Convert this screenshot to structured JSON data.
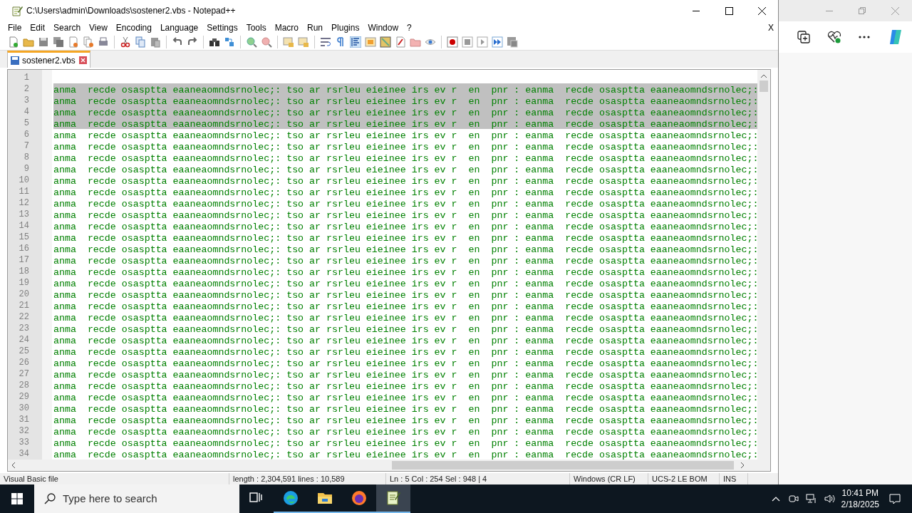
{
  "window": {
    "title": "C:\\Users\\admin\\Downloads\\sostener2.vbs - Notepad++"
  },
  "menu": [
    "File",
    "Edit",
    "Search",
    "View",
    "Encoding",
    "Language",
    "Settings",
    "Tools",
    "Macro",
    "Run",
    "Plugins",
    "Window",
    "?"
  ],
  "menu_close": "X",
  "tabs": [
    {
      "label": "sostener2.vbs",
      "selected": true
    }
  ],
  "editor": {
    "lines": [
      {
        "number": "1",
        "selected": false
      },
      {
        "number": "2",
        "text": "anma  recde osasptta eaaneaomndsrnolec;: tso ar rsrleu eieinee irs ev r  en  pnr : eanma  recde osasptta eaaneaomndsrnolec;:",
        "selected": true
      },
      {
        "number": "3",
        "text": "anma  recde osasptta eaaneaomndsrnolec;: tso ar rsrleu eieinee irs ev r  en  pnr : eanma  recde osasptta eaaneaomndsrnolec;:",
        "selected": true
      },
      {
        "number": "4",
        "text": "anma  recde osasptta eaaneaomndsrnolec;: tso ar rsrleu eieinee irs ev r  en  pnr : eanma  recde osasptta eaaneaomndsrnolec;:",
        "selected": true
      },
      {
        "number": "5",
        "text": "anma  recde osasptta eaaneaomndsrnolec;: tso ar rsrleu eieinee irs ev r  en  pnr : eanma  recde osasptta eaaneaomndsrnolec;:",
        "selected": true
      },
      {
        "number": "6",
        "text": "anma  recde osasptta eaaneaomndsrnolec;: tso ar rsrleu eieinee irs ev r  en  pnr : eanma  recde osasptta eaaneaomndsrnolec;:",
        "selected": false
      },
      {
        "number": "7",
        "text": "anma  recde osasptta eaaneaomndsrnolec;: tso ar rsrleu eieinee irs ev r  en  pnr : eanma  recde osasptta eaaneaomndsrnolec;:",
        "selected": false
      },
      {
        "number": "8",
        "text": "anma  recde osasptta eaaneaomndsrnolec;: tso ar rsrleu eieinee irs ev r  en  pnr : eanma  recde osasptta eaaneaomndsrnolec;:",
        "selected": false
      },
      {
        "number": "9",
        "text": "anma  recde osasptta eaaneaomndsrnolec;: tso ar rsrleu eieinee irs ev r  en  pnr : eanma  recde osasptta eaaneaomndsrnolec;:",
        "selected": false
      },
      {
        "number": "10",
        "text": "anma  recde osasptta eaaneaomndsrnolec;: tso ar rsrleu eieinee irs ev r  en  pnr : eanma  recde osasptta eaaneaomndsrnolec;:",
        "selected": false
      },
      {
        "number": "11",
        "text": "anma  recde osasptta eaaneaomndsrnolec;: tso ar rsrleu eieinee irs ev r  en  pnr : eanma  recde osasptta eaaneaomndsrnolec;:",
        "selected": false
      },
      {
        "number": "12",
        "text": "anma  recde osasptta eaaneaomndsrnolec;: tso ar rsrleu eieinee irs ev r  en  pnr : eanma  recde osasptta eaaneaomndsrnolec;:",
        "selected": false
      },
      {
        "number": "13",
        "text": "anma  recde osasptta eaaneaomndsrnolec;: tso ar rsrleu eieinee irs ev r  en  pnr : eanma  recde osasptta eaaneaomndsrnolec;:",
        "selected": false
      },
      {
        "number": "14",
        "text": "anma  recde osasptta eaaneaomndsrnolec;: tso ar rsrleu eieinee irs ev r  en  pnr : eanma  recde osasptta eaaneaomndsrnolec;:",
        "selected": false
      },
      {
        "number": "15",
        "text": "anma  recde osasptta eaaneaomndsrnolec;: tso ar rsrleu eieinee irs ev r  en  pnr : eanma  recde osasptta eaaneaomndsrnolec;:",
        "selected": false
      },
      {
        "number": "16",
        "text": "anma  recde osasptta eaaneaomndsrnolec;: tso ar rsrleu eieinee irs ev r  en  pnr : eanma  recde osasptta eaaneaomndsrnolec;:",
        "selected": false
      },
      {
        "number": "17",
        "text": "anma  recde osasptta eaaneaomndsrnolec;: tso ar rsrleu eieinee irs ev r  en  pnr : eanma  recde osasptta eaaneaomndsrnolec;:",
        "selected": false
      },
      {
        "number": "18",
        "text": "anma  recde osasptta eaaneaomndsrnolec;: tso ar rsrleu eieinee irs ev r  en  pnr : eanma  recde osasptta eaaneaomndsrnolec;:",
        "selected": false
      },
      {
        "number": "19",
        "text": "anma  recde osasptta eaaneaomndsrnolec;: tso ar rsrleu eieinee irs ev r  en  pnr : eanma  recde osasptta eaaneaomndsrnolec;:",
        "selected": false
      },
      {
        "number": "20",
        "text": "anma  recde osasptta eaaneaomndsrnolec;: tso ar rsrleu eieinee irs ev r  en  pnr : eanma  recde osasptta eaaneaomndsrnolec;:",
        "selected": false
      },
      {
        "number": "21",
        "text": "anma  recde osasptta eaaneaomndsrnolec;: tso ar rsrleu eieinee irs ev r  en  pnr : eanma  recde osasptta eaaneaomndsrnolec;:",
        "selected": false
      },
      {
        "number": "22",
        "text": "anma  recde osasptta eaaneaomndsrnolec;: tso ar rsrleu eieinee irs ev r  en  pnr : eanma  recde osasptta eaaneaomndsrnolec;:",
        "selected": false
      },
      {
        "number": "23",
        "text": "anma  recde osasptta eaaneaomndsrnolec;: tso ar rsrleu eieinee irs ev r  en  pnr : eanma  recde osasptta eaaneaomndsrnolec;:",
        "selected": false
      },
      {
        "number": "24",
        "text": "anma  recde osasptta eaaneaomndsrnolec;: tso ar rsrleu eieinee irs ev r  en  pnr : eanma  recde osasptta eaaneaomndsrnolec;:",
        "selected": false
      },
      {
        "number": "25",
        "text": "anma  recde osasptta eaaneaomndsrnolec;: tso ar rsrleu eieinee irs ev r  en  pnr : eanma  recde osasptta eaaneaomndsrnolec;:",
        "selected": false
      },
      {
        "number": "26",
        "text": "anma  recde osasptta eaaneaomndsrnolec;: tso ar rsrleu eieinee irs ev r  en  pnr : eanma  recde osasptta eaaneaomndsrnolec;:",
        "selected": false
      },
      {
        "number": "27",
        "text": "anma  recde osasptta eaaneaomndsrnolec;: tso ar rsrleu eieinee irs ev r  en  pnr : eanma  recde osasptta eaaneaomndsrnolec;:",
        "selected": false
      },
      {
        "number": "28",
        "text": "anma  recde osasptta eaaneaomndsrnolec;: tso ar rsrleu eieinee irs ev r  en  pnr : eanma  recde osasptta eaaneaomndsrnolec;:",
        "selected": false
      },
      {
        "number": "29",
        "text": "anma  recde osasptta eaaneaomndsrnolec;: tso ar rsrleu eieinee irs ev r  en  pnr : eanma  recde osasptta eaaneaomndsrnolec;:",
        "selected": false
      },
      {
        "number": "30",
        "text": "anma  recde osasptta eaaneaomndsrnolec;: tso ar rsrleu eieinee irs ev r  en  pnr : eanma  recde osasptta eaaneaomndsrnolec;:",
        "selected": false
      },
      {
        "number": "31",
        "text": "anma  recde osasptta eaaneaomndsrnolec;: tso ar rsrleu eieinee irs ev r  en  pnr : eanma  recde osasptta eaaneaomndsrnolec;:",
        "selected": false
      },
      {
        "number": "32",
        "text": "anma  recde osasptta eaaneaomndsrnolec;: tso ar rsrleu eieinee irs ev r  en  pnr : eanma  recde osasptta eaaneaomndsrnolec;:",
        "selected": false
      },
      {
        "number": "33",
        "text": "anma  recde osasptta eaaneaomndsrnolec;: tso ar rsrleu eieinee irs ev r  en  pnr : eanma  recde osasptta eaaneaomndsrnolec;:",
        "selected": false
      },
      {
        "number": "34",
        "text": "anma  recde osasptta eaaneaomndsrnolec;: tso ar rsrleu eieinee irs ev r  en  pnr : eanma  recde osasptta eaaneaomndsrnolec;:",
        "selected": false
      }
    ]
  },
  "status_bar": [
    "Visual Basic file",
    "length : 2,304,591    lines : 10,589",
    "Ln : 5    Col : 254    Sel : 948 | 4",
    "Windows (CR LF)",
    "UCS-2 LE BOM",
    "INS"
  ],
  "taskbar": {
    "search_placeholder": "Type here to search",
    "apps": [
      {
        "kind": "taskview",
        "running": false,
        "active": false
      },
      {
        "kind": "edge",
        "running": true,
        "active": false
      },
      {
        "kind": "explorer",
        "running": true,
        "active": false
      },
      {
        "kind": "firefox",
        "running": true,
        "active": false
      },
      {
        "kind": "notepad",
        "running": true,
        "active": true
      }
    ],
    "clock": {
      "time": "10:41 PM",
      "date": "2/18/2025"
    }
  }
}
